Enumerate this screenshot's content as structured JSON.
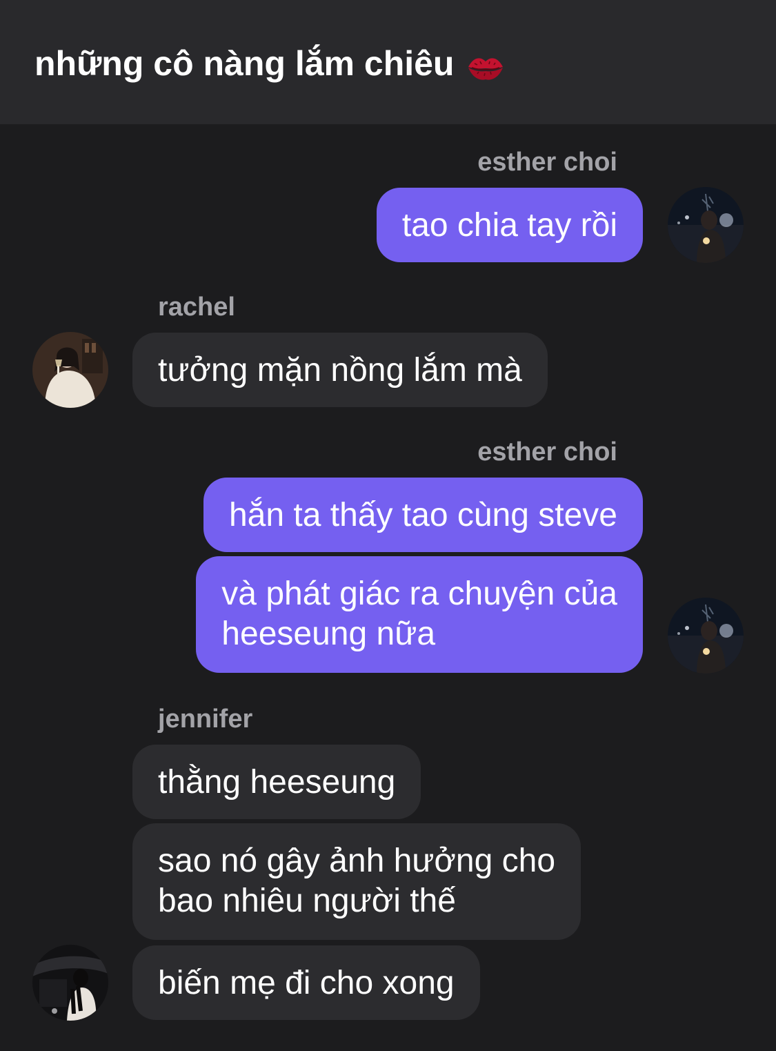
{
  "header": {
    "title": "những cô nàng lắm chiêu",
    "icon": "lips-icon"
  },
  "messages": [
    {
      "sender": "esther choi",
      "side": "out",
      "lines": [
        "tao chia tay rồi"
      ]
    },
    {
      "sender": "rachel",
      "side": "in",
      "lines": [
        "tưởng mặn nồng lắm mà"
      ]
    },
    {
      "sender": "esther choi",
      "side": "out",
      "lines": [
        "hắn ta thấy tao cùng steve"
      ]
    },
    {
      "sender": "esther choi",
      "side": "out",
      "lines": [
        "và phát giác ra chuyện của",
        "heeseung nữa"
      ]
    },
    {
      "sender": "jennifer",
      "side": "in",
      "lines": [
        "thằng heeseung"
      ]
    },
    {
      "sender": "jennifer",
      "side": "in",
      "lines": [
        "sao nó gây ảnh hưởng cho",
        "bao nhiêu người thế"
      ]
    },
    {
      "sender": "jennifer",
      "side": "in",
      "lines": [
        "biến mẹ đi cho xong"
      ]
    }
  ],
  "colors": {
    "background": "#1c1c1e",
    "header": "#29292c",
    "outgoing_bubble": "#7560f0",
    "incoming_bubble": "#2c2c2f",
    "sender_label": "#a3a3a8"
  }
}
